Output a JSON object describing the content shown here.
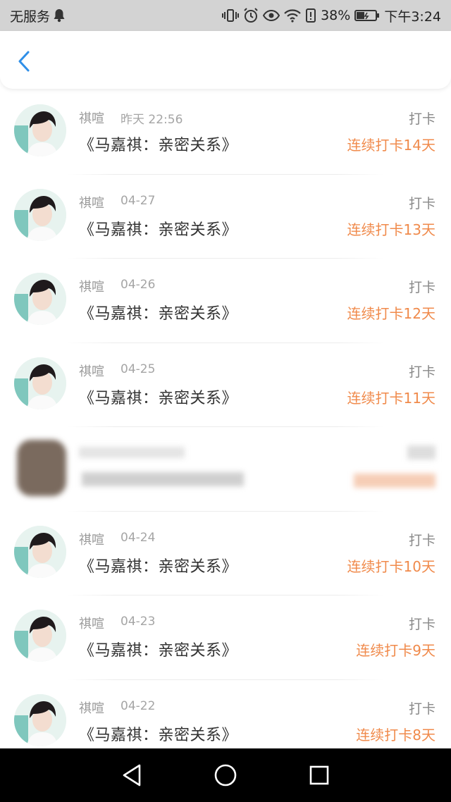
{
  "status_bar": {
    "carrier": "无服务",
    "battery_percent": "38%",
    "time": "下午3:24",
    "icons": [
      "notification-bell-icon",
      "vibrate-icon",
      "alarm-icon",
      "eye-comfort-icon",
      "wifi-icon",
      "battery-saver-icon",
      "battery-icon"
    ]
  },
  "header": {
    "back_icon": "chevron-left-icon",
    "accent_color": "#2f8fe8"
  },
  "feed": {
    "accent_color": "#f08a4b",
    "rows": [
      {
        "user": "祺喧",
        "time": "昨天 22:56",
        "title": "《马嘉祺：亲密关系》",
        "tag": "打卡",
        "streak": "连续打卡14天"
      },
      {
        "user": "祺喧",
        "time": "04-27",
        "title": "《马嘉祺：亲密关系》",
        "tag": "打卡",
        "streak": "连续打卡13天"
      },
      {
        "user": "祺喧",
        "time": "04-26",
        "title": "《马嘉祺：亲密关系》",
        "tag": "打卡",
        "streak": "连续打卡12天"
      },
      {
        "user": "祺喧",
        "time": "04-25",
        "title": "《马嘉祺：亲密关系》",
        "tag": "打卡",
        "streak": "连续打卡11天"
      },
      {
        "blurred": true
      },
      {
        "user": "祺喧",
        "time": "04-24",
        "title": "《马嘉祺：亲密关系》",
        "tag": "打卡",
        "streak": "连续打卡10天"
      },
      {
        "user": "祺喧",
        "time": "04-23",
        "title": "《马嘉祺：亲密关系》",
        "tag": "打卡",
        "streak": "连续打卡9天"
      },
      {
        "user": "祺喧",
        "time": "04-22",
        "title": "《马嘉祺：亲密关系》",
        "tag": "打卡",
        "streak": "连续打卡8天"
      }
    ]
  },
  "nav_bar": {
    "buttons": [
      "back-triangle-icon",
      "home-circle-icon",
      "recents-square-icon"
    ]
  }
}
